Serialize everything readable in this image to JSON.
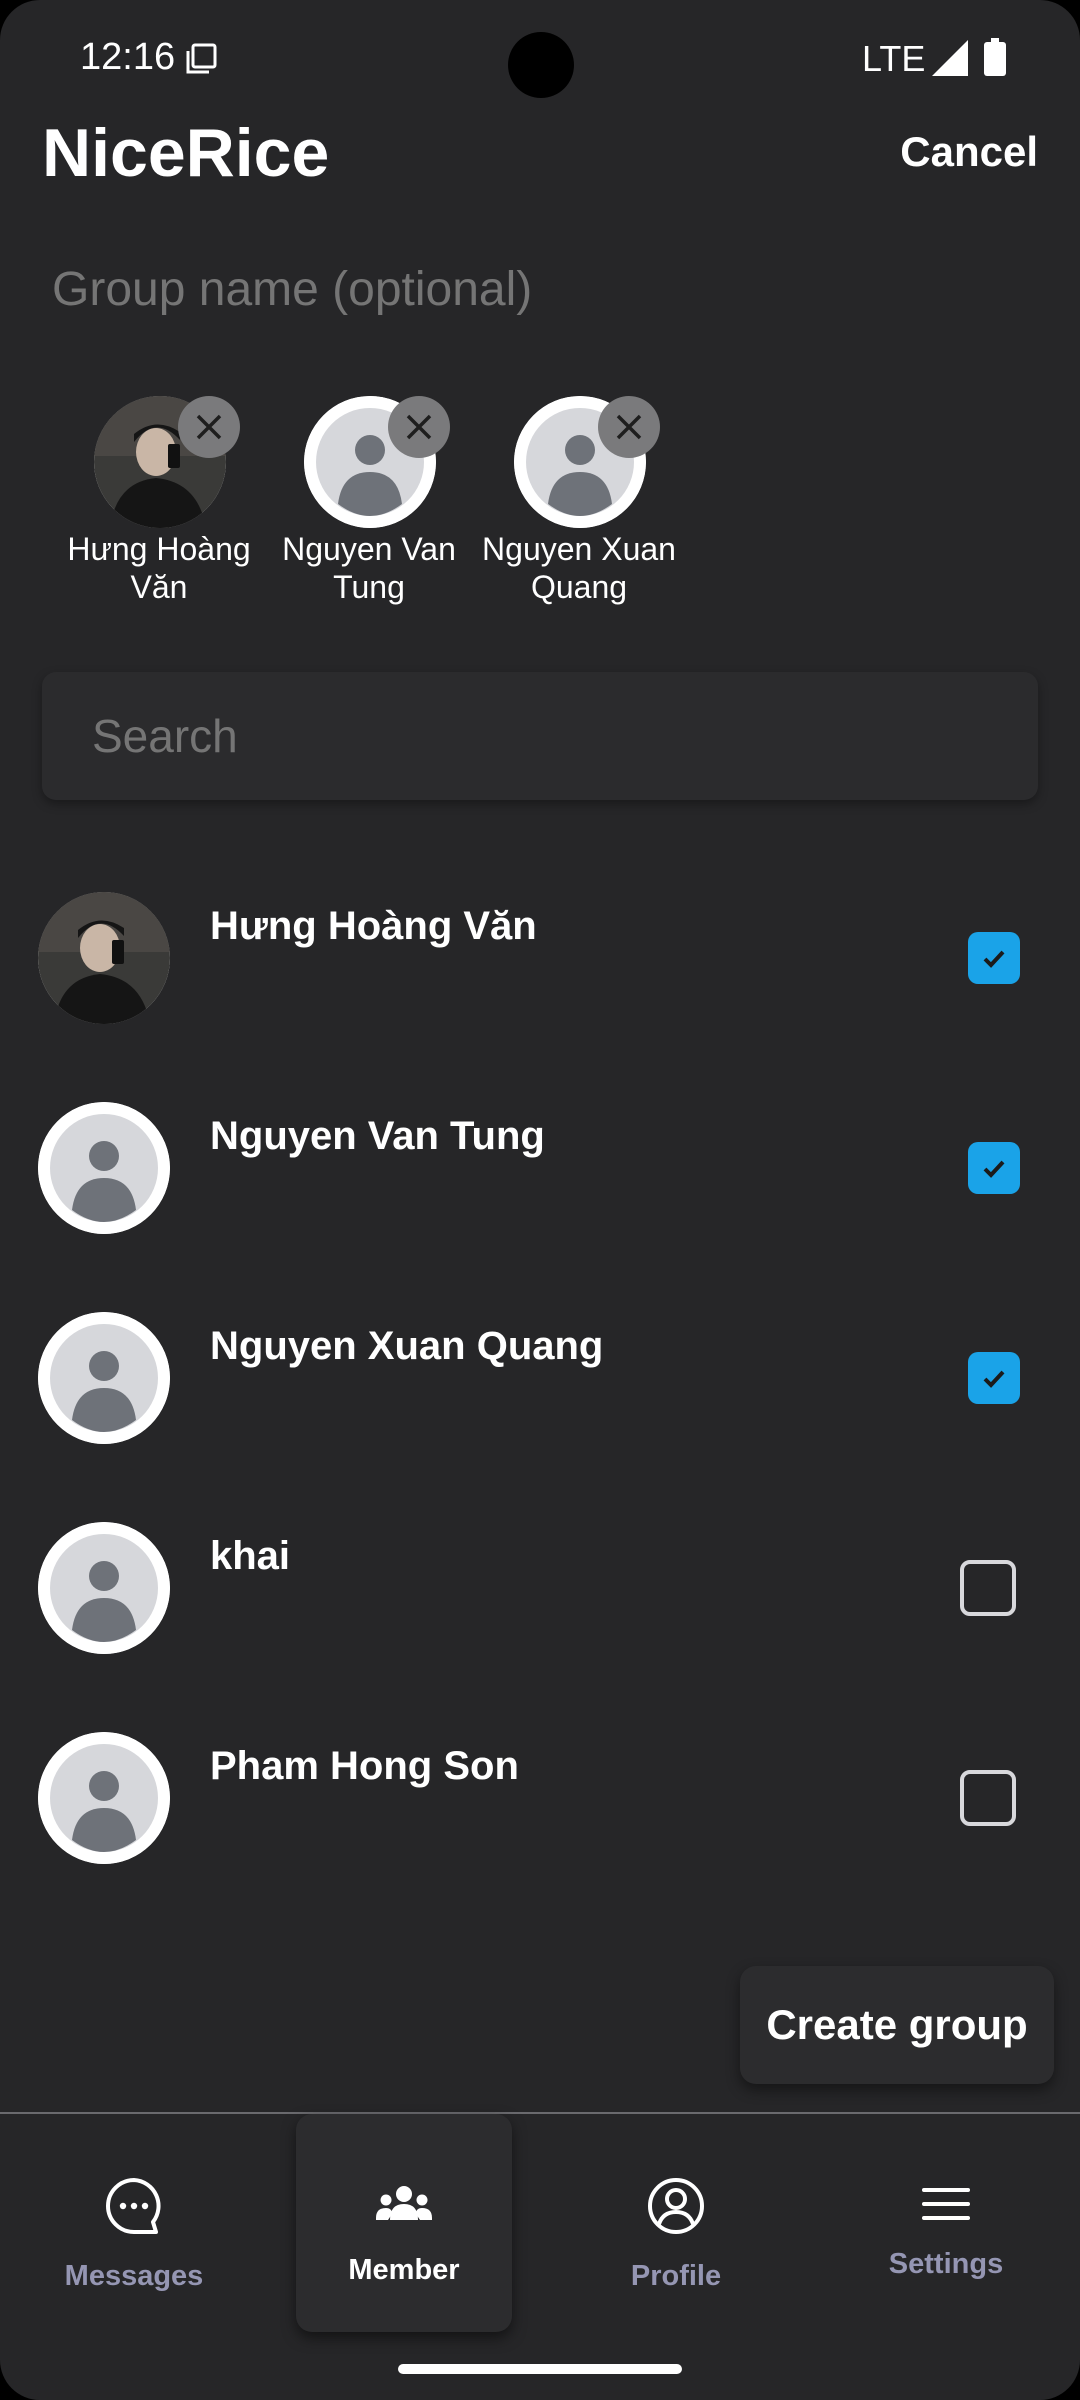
{
  "status_bar": {
    "time": "12:16",
    "network": "LTE"
  },
  "header": {
    "app_title": "NiceRice",
    "cancel_label": "Cancel"
  },
  "group_name": {
    "placeholder": "Group name (optional)",
    "value": ""
  },
  "selected_members": [
    {
      "name": "Hưng Hoàng Văn",
      "avatar": "photo"
    },
    {
      "name": "Nguyen Van Tung",
      "avatar": "default"
    },
    {
      "name": "Nguyen Xuan Quang",
      "avatar": "default"
    }
  ],
  "search": {
    "placeholder": "Search",
    "value": ""
  },
  "contacts": [
    {
      "name": "Hưng Hoàng Văn",
      "checked": true,
      "avatar": "photo"
    },
    {
      "name": "Nguyen Van Tung",
      "checked": true,
      "avatar": "default"
    },
    {
      "name": "Nguyen Xuan Quang",
      "checked": true,
      "avatar": "default"
    },
    {
      "name": "khai",
      "checked": false,
      "avatar": "default"
    },
    {
      "name": "Pham Hong Son",
      "checked": false,
      "avatar": "default"
    }
  ],
  "create_group_label": "Create group",
  "bottom_nav": [
    {
      "label": "Messages",
      "icon": "chat-bubble-icon",
      "active": false
    },
    {
      "label": "Member",
      "icon": "group-icon",
      "active": true
    },
    {
      "label": "Profile",
      "icon": "user-circle-icon",
      "active": false
    },
    {
      "label": "Settings",
      "icon": "menu-icon",
      "active": false
    }
  ],
  "colors": {
    "background": "#262628",
    "accent": "#1aa3e8",
    "muted_text": "#9596b3"
  }
}
